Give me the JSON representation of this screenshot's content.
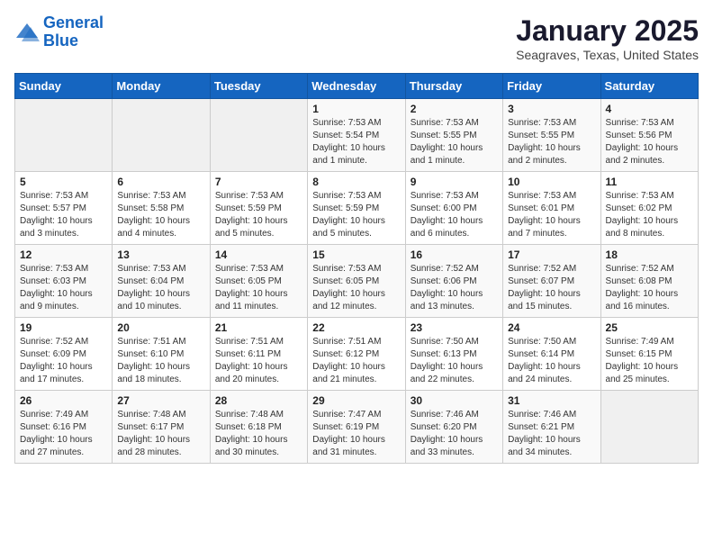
{
  "logo": {
    "line1": "General",
    "line2": "Blue"
  },
  "title": "January 2025",
  "subtitle": "Seagraves, Texas, United States",
  "weekdays": [
    "Sunday",
    "Monday",
    "Tuesday",
    "Wednesday",
    "Thursday",
    "Friday",
    "Saturday"
  ],
  "weeks": [
    [
      {
        "day": "",
        "sunrise": "",
        "sunset": "",
        "daylight": ""
      },
      {
        "day": "",
        "sunrise": "",
        "sunset": "",
        "daylight": ""
      },
      {
        "day": "",
        "sunrise": "",
        "sunset": "",
        "daylight": ""
      },
      {
        "day": "1",
        "sunrise": "Sunrise: 7:53 AM",
        "sunset": "Sunset: 5:54 PM",
        "daylight": "Daylight: 10 hours and 1 minute."
      },
      {
        "day": "2",
        "sunrise": "Sunrise: 7:53 AM",
        "sunset": "Sunset: 5:55 PM",
        "daylight": "Daylight: 10 hours and 1 minute."
      },
      {
        "day": "3",
        "sunrise": "Sunrise: 7:53 AM",
        "sunset": "Sunset: 5:55 PM",
        "daylight": "Daylight: 10 hours and 2 minutes."
      },
      {
        "day": "4",
        "sunrise": "Sunrise: 7:53 AM",
        "sunset": "Sunset: 5:56 PM",
        "daylight": "Daylight: 10 hours and 2 minutes."
      }
    ],
    [
      {
        "day": "5",
        "sunrise": "Sunrise: 7:53 AM",
        "sunset": "Sunset: 5:57 PM",
        "daylight": "Daylight: 10 hours and 3 minutes."
      },
      {
        "day": "6",
        "sunrise": "Sunrise: 7:53 AM",
        "sunset": "Sunset: 5:58 PM",
        "daylight": "Daylight: 10 hours and 4 minutes."
      },
      {
        "day": "7",
        "sunrise": "Sunrise: 7:53 AM",
        "sunset": "Sunset: 5:59 PM",
        "daylight": "Daylight: 10 hours and 5 minutes."
      },
      {
        "day": "8",
        "sunrise": "Sunrise: 7:53 AM",
        "sunset": "Sunset: 5:59 PM",
        "daylight": "Daylight: 10 hours and 5 minutes."
      },
      {
        "day": "9",
        "sunrise": "Sunrise: 7:53 AM",
        "sunset": "Sunset: 6:00 PM",
        "daylight": "Daylight: 10 hours and 6 minutes."
      },
      {
        "day": "10",
        "sunrise": "Sunrise: 7:53 AM",
        "sunset": "Sunset: 6:01 PM",
        "daylight": "Daylight: 10 hours and 7 minutes."
      },
      {
        "day": "11",
        "sunrise": "Sunrise: 7:53 AM",
        "sunset": "Sunset: 6:02 PM",
        "daylight": "Daylight: 10 hours and 8 minutes."
      }
    ],
    [
      {
        "day": "12",
        "sunrise": "Sunrise: 7:53 AM",
        "sunset": "Sunset: 6:03 PM",
        "daylight": "Daylight: 10 hours and 9 minutes."
      },
      {
        "day": "13",
        "sunrise": "Sunrise: 7:53 AM",
        "sunset": "Sunset: 6:04 PM",
        "daylight": "Daylight: 10 hours and 10 minutes."
      },
      {
        "day": "14",
        "sunrise": "Sunrise: 7:53 AM",
        "sunset": "Sunset: 6:05 PM",
        "daylight": "Daylight: 10 hours and 11 minutes."
      },
      {
        "day": "15",
        "sunrise": "Sunrise: 7:53 AM",
        "sunset": "Sunset: 6:05 PM",
        "daylight": "Daylight: 10 hours and 12 minutes."
      },
      {
        "day": "16",
        "sunrise": "Sunrise: 7:52 AM",
        "sunset": "Sunset: 6:06 PM",
        "daylight": "Daylight: 10 hours and 13 minutes."
      },
      {
        "day": "17",
        "sunrise": "Sunrise: 7:52 AM",
        "sunset": "Sunset: 6:07 PM",
        "daylight": "Daylight: 10 hours and 15 minutes."
      },
      {
        "day": "18",
        "sunrise": "Sunrise: 7:52 AM",
        "sunset": "Sunset: 6:08 PM",
        "daylight": "Daylight: 10 hours and 16 minutes."
      }
    ],
    [
      {
        "day": "19",
        "sunrise": "Sunrise: 7:52 AM",
        "sunset": "Sunset: 6:09 PM",
        "daylight": "Daylight: 10 hours and 17 minutes."
      },
      {
        "day": "20",
        "sunrise": "Sunrise: 7:51 AM",
        "sunset": "Sunset: 6:10 PM",
        "daylight": "Daylight: 10 hours and 18 minutes."
      },
      {
        "day": "21",
        "sunrise": "Sunrise: 7:51 AM",
        "sunset": "Sunset: 6:11 PM",
        "daylight": "Daylight: 10 hours and 20 minutes."
      },
      {
        "day": "22",
        "sunrise": "Sunrise: 7:51 AM",
        "sunset": "Sunset: 6:12 PM",
        "daylight": "Daylight: 10 hours and 21 minutes."
      },
      {
        "day": "23",
        "sunrise": "Sunrise: 7:50 AM",
        "sunset": "Sunset: 6:13 PM",
        "daylight": "Daylight: 10 hours and 22 minutes."
      },
      {
        "day": "24",
        "sunrise": "Sunrise: 7:50 AM",
        "sunset": "Sunset: 6:14 PM",
        "daylight": "Daylight: 10 hours and 24 minutes."
      },
      {
        "day": "25",
        "sunrise": "Sunrise: 7:49 AM",
        "sunset": "Sunset: 6:15 PM",
        "daylight": "Daylight: 10 hours and 25 minutes."
      }
    ],
    [
      {
        "day": "26",
        "sunrise": "Sunrise: 7:49 AM",
        "sunset": "Sunset: 6:16 PM",
        "daylight": "Daylight: 10 hours and 27 minutes."
      },
      {
        "day": "27",
        "sunrise": "Sunrise: 7:48 AM",
        "sunset": "Sunset: 6:17 PM",
        "daylight": "Daylight: 10 hours and 28 minutes."
      },
      {
        "day": "28",
        "sunrise": "Sunrise: 7:48 AM",
        "sunset": "Sunset: 6:18 PM",
        "daylight": "Daylight: 10 hours and 30 minutes."
      },
      {
        "day": "29",
        "sunrise": "Sunrise: 7:47 AM",
        "sunset": "Sunset: 6:19 PM",
        "daylight": "Daylight: 10 hours and 31 minutes."
      },
      {
        "day": "30",
        "sunrise": "Sunrise: 7:46 AM",
        "sunset": "Sunset: 6:20 PM",
        "daylight": "Daylight: 10 hours and 33 minutes."
      },
      {
        "day": "31",
        "sunrise": "Sunrise: 7:46 AM",
        "sunset": "Sunset: 6:21 PM",
        "daylight": "Daylight: 10 hours and 34 minutes."
      },
      {
        "day": "",
        "sunrise": "",
        "sunset": "",
        "daylight": ""
      }
    ]
  ]
}
